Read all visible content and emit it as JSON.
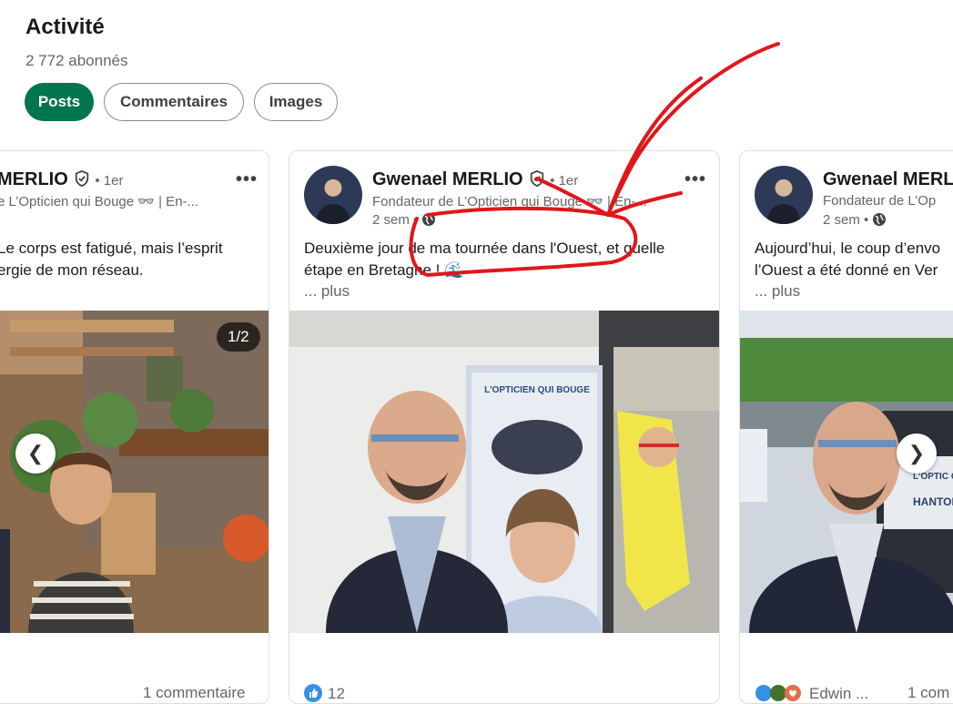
{
  "header": {
    "title": "Activité",
    "followers": "2 772 abonnés"
  },
  "tabs": [
    {
      "label": "Posts",
      "active": true
    },
    {
      "label": "Commentaires",
      "active": false
    },
    {
      "label": "Images",
      "active": false
    }
  ],
  "posts": [
    {
      "author_visible": "MERLIO",
      "degree": "• 1er",
      "headline": "e L’Opticien qui Bouge 👓 | En-...",
      "text_line1": "Le corps est fatigué, mais l’esprit",
      "text_line2": "ergie de mon réseau.",
      "image_counter": "1/2",
      "footer": "1 commentaire"
    },
    {
      "author": "Gwenael MERLIO",
      "degree": "• 1er",
      "headline": "Fondateur de L’Opticien qui Bouge 👓 | En-...",
      "time": "2 sem •",
      "text_line1": "Deuxième jour de ma tournée dans l'Ouest, et quelle",
      "text_line2": "étape en Bretagne ! 🌊",
      "see_more": "... plus",
      "reactions_count": "12"
    },
    {
      "author_visible": "Gwenael MERL",
      "headline": "Fondateur de L’Op",
      "time": "2 sem •",
      "text_line1": "Aujourd’hui, le coup d’envo",
      "text_line2": "l’Ouest a été donné en Ver",
      "see_more": "... plus",
      "reaction_name": "Edwin ...",
      "footer": "1 com"
    }
  ],
  "photo_texts": {
    "banner_brand": "L'OPTICIEN QUI BOUGE",
    "van_brand": "L'OPTIC QUI BO",
    "van_word": "HANTON"
  },
  "nav": {
    "prev": "❮",
    "next": "❯"
  },
  "colors": {
    "active_tab": "#01754f",
    "annotation": "#e0171b",
    "like_blue": "#378fe9"
  },
  "icons": [
    "verified-icon",
    "globe-icon",
    "more-options-icon",
    "like-icon",
    "celebrate-icon",
    "love-icon",
    "chevron-left-icon",
    "chevron-right-icon"
  ]
}
